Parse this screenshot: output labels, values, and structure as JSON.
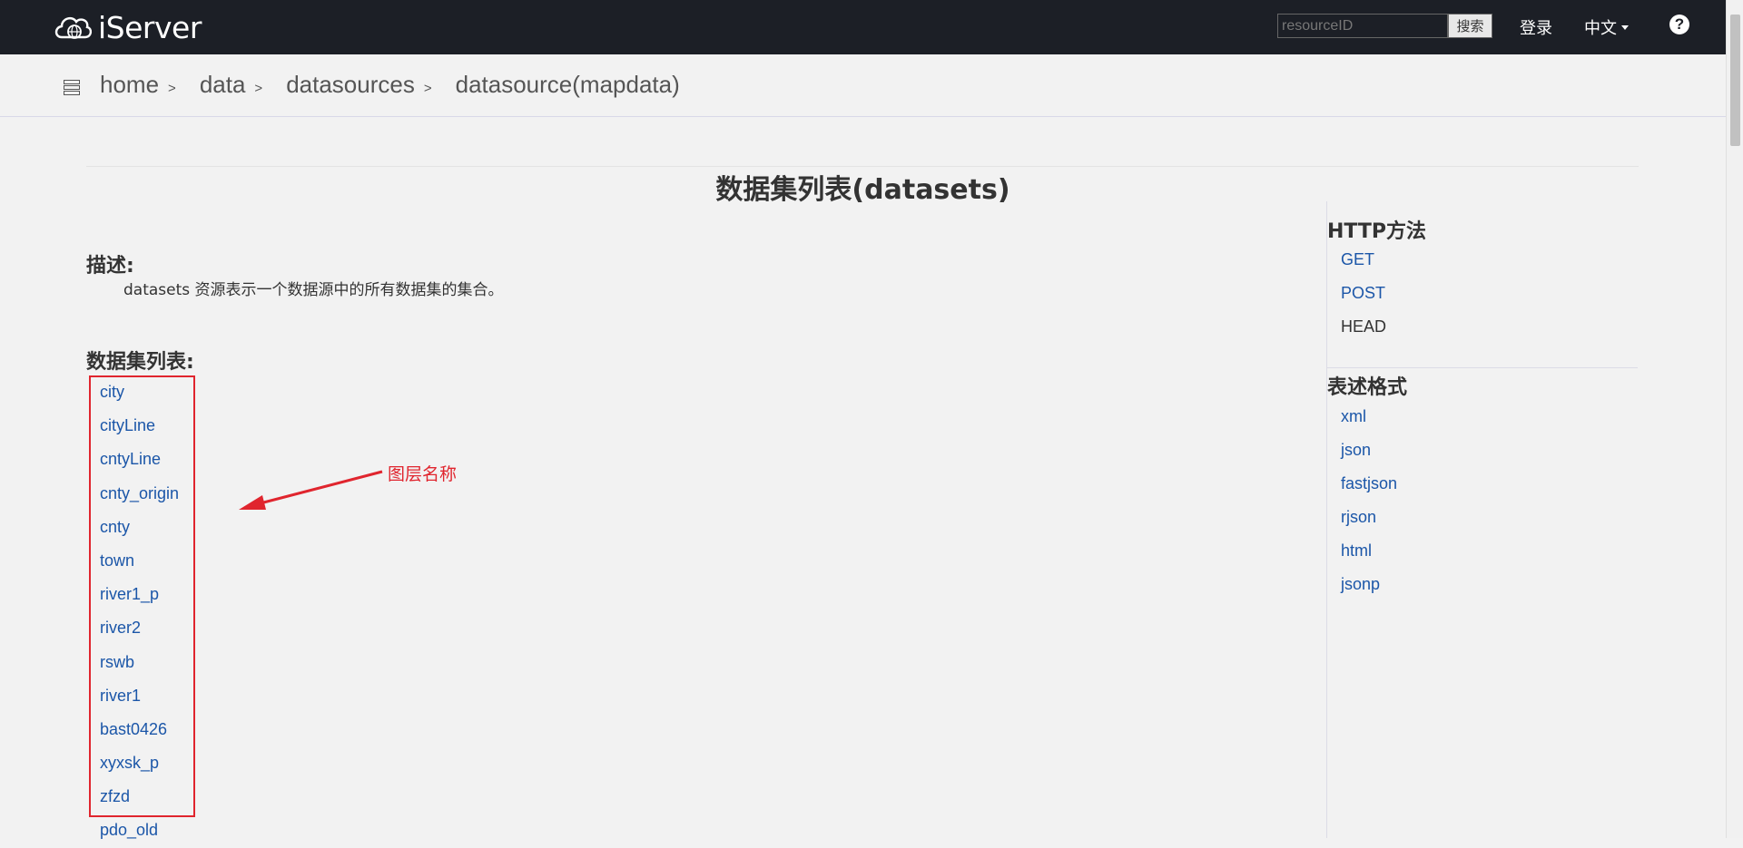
{
  "navbar": {
    "brand": "iServer",
    "search_placeholder": "resourceID",
    "search_button": "搜索",
    "login": "登录",
    "language": "中文",
    "help": "?"
  },
  "breadcrumb": [
    "home",
    "data",
    "datasources",
    "datasource(mapdata)"
  ],
  "breadcrumb_sep": ">",
  "page": {
    "title": "数据集列表(datasets)",
    "desc_heading": "描述:",
    "desc_text": "datasets 资源表示一个数据源中的所有数据集的集合。",
    "list_heading": "数据集列表:",
    "datasets": [
      "city",
      "cityLine",
      "cntyLine",
      "cnty_origin",
      "cnty",
      "town",
      "river1_p",
      "river2",
      "rswb",
      "river1",
      "bast0426",
      "xyxsk_p",
      "zfzd",
      "pdo_old"
    ]
  },
  "annotation": {
    "label": "图层名称",
    "color": "#e0252e"
  },
  "sidebar": {
    "http_heading": "HTTP方法",
    "http_methods": [
      "GET",
      "POST",
      "HEAD"
    ],
    "format_heading": "表述格式",
    "formats": [
      "xml",
      "json",
      "fastjson",
      "rjson",
      "html",
      "jsonp"
    ]
  },
  "colors": {
    "navbar_bg": "#1c1f26",
    "link": "#1b56a8",
    "page_bg": "#f2f2f2"
  }
}
